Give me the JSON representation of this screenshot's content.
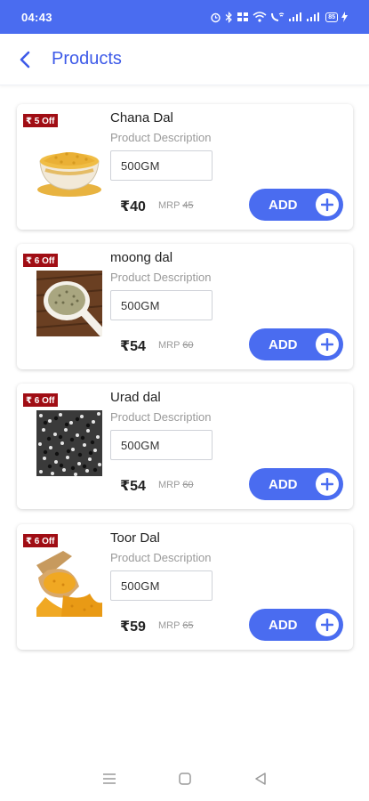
{
  "status_bar": {
    "time": "04:43",
    "battery": "85"
  },
  "header": {
    "title": "Products"
  },
  "colors": {
    "primary": "#4a6cf0",
    "title": "#3d5ae8",
    "badge": "#a00d14"
  },
  "products": [
    {
      "badge": "₹ 5 Off",
      "name": "Chana Dal",
      "description": "Product Description",
      "quantity": "500GM",
      "price": "₹40",
      "mrp_label": "MRP",
      "mrp_value": "45",
      "add_label": "ADD",
      "image": "chana-dal-bowl"
    },
    {
      "badge": "₹ 6 Off",
      "name": "moong dal",
      "description": "Product Description",
      "quantity": "500GM",
      "price": "₹54",
      "mrp_label": "MRP",
      "mrp_value": "60",
      "add_label": "ADD",
      "image": "moong-dal-spoon"
    },
    {
      "badge": "₹ 6 Off",
      "name": "Urad dal",
      "description": "Product Description",
      "quantity": "500GM",
      "price": "₹54",
      "mrp_label": "MRP",
      "mrp_value": "60",
      "add_label": "ADD",
      "image": "urad-dal-grains"
    },
    {
      "badge": "₹ 6 Off",
      "name": "Toor Dal",
      "description": "Product Description",
      "quantity": "500GM",
      "price": "₹59",
      "mrp_label": "MRP",
      "mrp_value": "65",
      "add_label": "ADD",
      "image": "toor-dal-scoop"
    }
  ],
  "nav": {
    "icons": [
      "menu-icon",
      "home-icon",
      "back-triangle-icon"
    ]
  }
}
